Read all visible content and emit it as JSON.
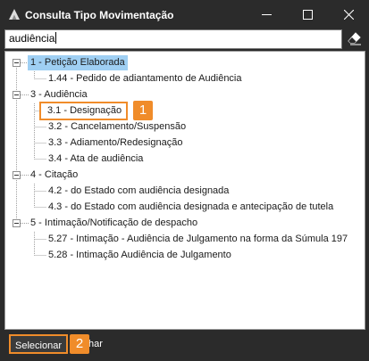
{
  "window": {
    "title": "Consulta Tipo Movimentação"
  },
  "search": {
    "value": "audiência"
  },
  "tree": {
    "nodes": {
      "n1": "1 - Petição Elaborada",
      "n1_1": "1.44 - Pedido de adiantamento de Audiência",
      "n3": "3 - Audiência",
      "n3_1": "3.1 - Designação",
      "n3_2": "3.2 - Cancelamento/Suspensão",
      "n3_3": "3.3 - Adiamento/Redesignação",
      "n3_4": "3.4 - Ata de audiência",
      "n4": "4 - Citação",
      "n4_2": "4.2 - do Estado com audiência designada",
      "n4_3": "4.3 - do Estado com audiência designada e antecipação de tutela",
      "n5": "5 - Intimação/Notificação de despacho",
      "n5_27": "5.27 - Intimação - Audiência de Julgamento na forma da Súmula 197",
      "n5_28": "5.28 - Intimação Audiência de Julgamento"
    }
  },
  "annotations": {
    "badge1": "1",
    "badge2": "2"
  },
  "footer": {
    "select_label": "Selecionar",
    "other_label_visible": "har"
  },
  "colors": {
    "accent": "#f08c2a",
    "selection": "#9fcff3",
    "chrome": "#2b2b2b"
  },
  "icons": {
    "app": "app-window-icon",
    "clear": "eraser-icon",
    "minimize": "minimize-icon",
    "maximize": "maximize-icon",
    "close": "close-icon"
  }
}
